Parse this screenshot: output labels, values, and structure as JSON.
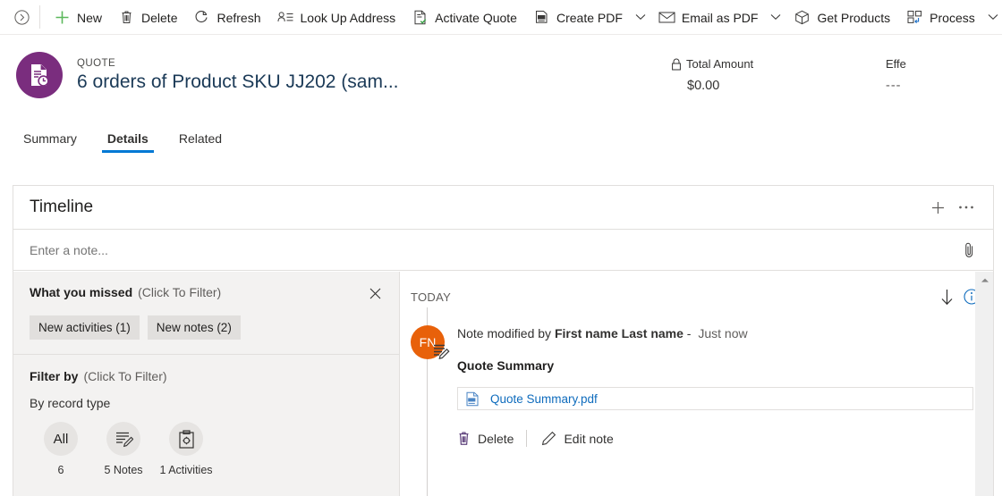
{
  "commandbar": {
    "collapse_tooltip": "Expand",
    "buttons": [
      {
        "icon": "plus-icon",
        "label": "New",
        "caret": false
      },
      {
        "icon": "trash-icon",
        "label": "Delete",
        "caret": false
      },
      {
        "icon": "refresh-icon",
        "label": "Refresh",
        "caret": false
      },
      {
        "icon": "lookup-address-icon",
        "label": "Look Up Address",
        "caret": false
      },
      {
        "icon": "activate-quote-icon",
        "label": "Activate Quote",
        "caret": false
      },
      {
        "icon": "create-pdf-icon",
        "label": "Create PDF",
        "caret": true
      },
      {
        "icon": "email-icon",
        "label": "Email as PDF",
        "caret": true
      },
      {
        "icon": "product-box-icon",
        "label": "Get Products",
        "caret": false
      },
      {
        "icon": "process-icon",
        "label": "Process",
        "caret": true
      }
    ]
  },
  "record": {
    "entity_type": "QUOTE",
    "name": "6 orders of Product SKU JJ202 (sam...",
    "avatar_color": "#7a2d7e",
    "fields": [
      {
        "label": "Total Amount",
        "value": "$0.00",
        "locked": true
      },
      {
        "label": "Effe",
        "value": "---",
        "locked": false
      }
    ]
  },
  "tabs": [
    {
      "label": "Summary",
      "active": false
    },
    {
      "label": "Details",
      "active": true
    },
    {
      "label": "Related",
      "active": false
    }
  ],
  "timeline": {
    "title": "Timeline",
    "add_icon": "plus-icon",
    "more_icon": "ellipsis-icon",
    "note_placeholder": "Enter a note...",
    "attach_icon": "paperclip-icon",
    "filter_pane": {
      "missed_title": "What you missed",
      "missed_subtitle": "(Click To Filter)",
      "close_icon": "close-icon",
      "chips": [
        {
          "label": "New activities (1)"
        },
        {
          "label": "New notes (2)"
        }
      ],
      "filterby_title": "Filter by",
      "filterby_subtitle": "(Click To Filter)",
      "group_label": "By record type",
      "record_types": [
        {
          "icon": "all-text",
          "glyph": "All",
          "caption": "6"
        },
        {
          "icon": "notes-icon",
          "glyph": "",
          "caption": "5 Notes"
        },
        {
          "icon": "activities-icon",
          "glyph": "",
          "caption": "1 Activities"
        }
      ]
    },
    "feed": {
      "group_label": "TODAY",
      "sort_icon": "sort-down-icon",
      "info_icon": "info-icon",
      "entries": [
        {
          "avatar_initials": "FN",
          "avatar_color": "#e8610a",
          "badge_icon": "note-edit-icon",
          "prefix": "Note modified by ",
          "actor": "First name Last name",
          "separator": " - ",
          "timestamp": "Just now",
          "subject": "Quote Summary",
          "attachment": {
            "icon": "pdf-icon",
            "name": "Quote Summary.pdf"
          },
          "actions": [
            {
              "icon": "trash-icon",
              "label": "Delete"
            },
            {
              "icon": "pencil-icon",
              "label": "Edit note"
            }
          ]
        }
      ]
    },
    "scrollbar": {
      "up_icon": "caret-up-icon"
    }
  },
  "colors": {
    "accent": "#0078d4",
    "link": "#0f6cbd",
    "panel_bg": "#f3f2f1",
    "chip_bg": "#e1dfdd"
  }
}
